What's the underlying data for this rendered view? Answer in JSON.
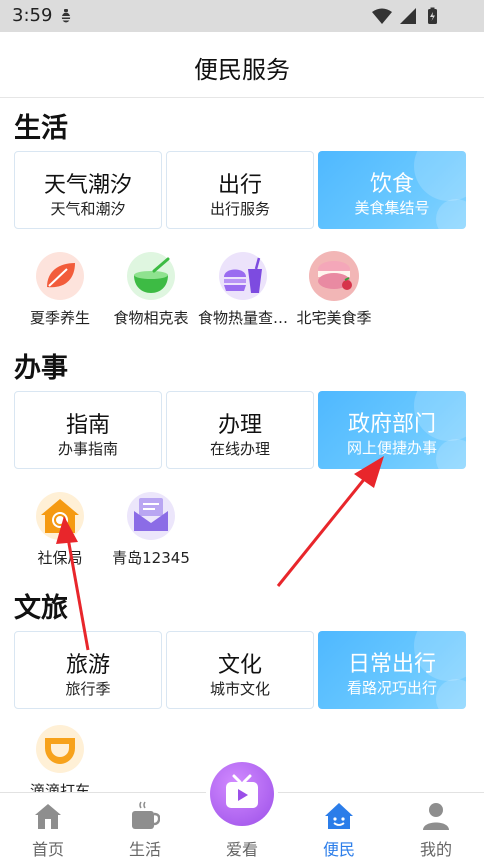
{
  "status": {
    "time": "3:59"
  },
  "header": {
    "title": "便民服务"
  },
  "sections": [
    {
      "title": "生活",
      "cards": [
        {
          "big": "天气潮汐",
          "small": "天气和潮汐"
        },
        {
          "big": "出行",
          "small": "出行服务"
        },
        {
          "big": "饮食",
          "small": "美食集结号"
        }
      ],
      "icons": [
        {
          "label": "夏季养生",
          "icon": "leaf-icon"
        },
        {
          "label": "食物相克表",
          "icon": "bowl-icon"
        },
        {
          "label": "食物热量查…",
          "icon": "burger-drink-icon"
        },
        {
          "label": "北宅美食季",
          "icon": "macaron-icon"
        }
      ]
    },
    {
      "title": "办事",
      "cards": [
        {
          "big": "指南",
          "small": "办事指南"
        },
        {
          "big": "办理",
          "small": "在线办理"
        },
        {
          "big": "政府部门",
          "small": "网上便捷办事"
        }
      ],
      "icons": [
        {
          "label": "社保局",
          "icon": "social-security-icon"
        },
        {
          "label": "青岛12345",
          "icon": "mail-icon"
        }
      ]
    },
    {
      "title": "文旅",
      "cards": [
        {
          "big": "旅游",
          "small": "旅行季"
        },
        {
          "big": "文化",
          "small": "城市文化"
        },
        {
          "big": "日常出行",
          "small": "看路况巧出行"
        }
      ],
      "icons": [
        {
          "label": "滴滴打车",
          "icon": "didi-icon"
        }
      ]
    }
  ],
  "tabs": [
    {
      "label": "首页",
      "icon": "home-icon"
    },
    {
      "label": "生活",
      "icon": "coffee-cup-icon"
    },
    {
      "label": "爱看",
      "icon": "tv-icon"
    },
    {
      "label": "便民",
      "icon": "smiley-house-icon"
    },
    {
      "label": "我的",
      "icon": "person-icon"
    }
  ],
  "colors": {
    "accent": "#2b7de9",
    "card_highlight": "#5bbdff",
    "annotation_arrow": "#e8262b"
  }
}
